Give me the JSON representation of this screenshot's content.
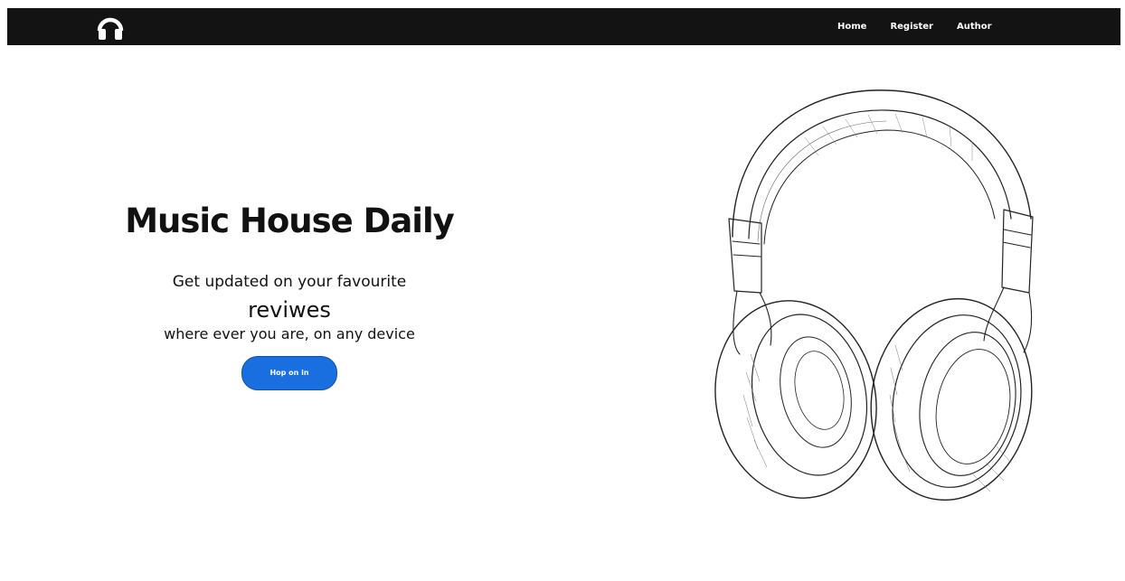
{
  "navbar": {
    "logo_icon": "headphones-icon",
    "links": [
      "Home",
      "Register",
      "Author"
    ],
    "background_color": "#131313"
  },
  "hero": {
    "title": "Music House Daily",
    "line1": "Get updated on your favourite",
    "line2": "reviwes",
    "line3": "where ever you are, on any device",
    "button_label": "Hop on in",
    "button_color": "#1a6fe0",
    "image_icon": "headphones-sketch-illustration"
  }
}
